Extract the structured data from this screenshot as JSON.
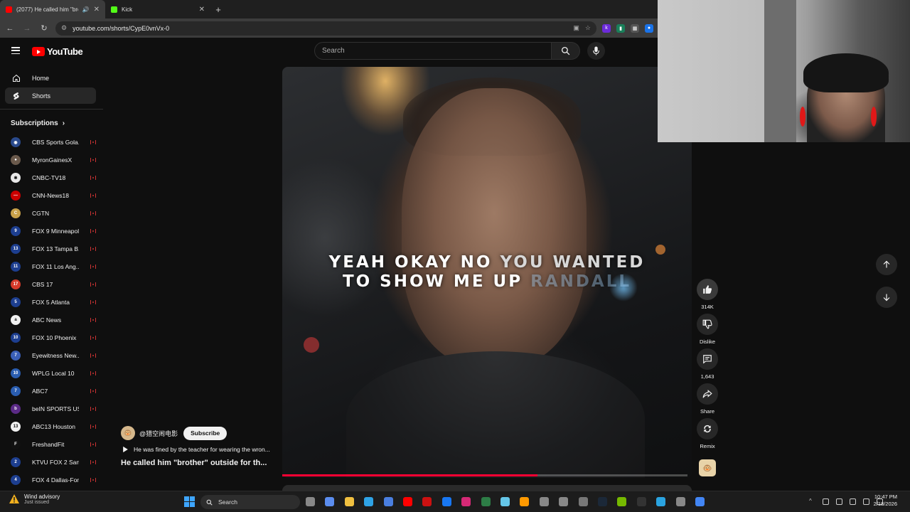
{
  "browser": {
    "tabs": [
      {
        "title": "(2077) He called him \"broth",
        "icon": "youtube-icon",
        "active": true
      },
      {
        "title": "Kick",
        "icon": "kick-icon",
        "active": false
      }
    ],
    "url": "youtube.com/shorts/CypE0vnVx-0"
  },
  "youtube": {
    "logo_text": "YouTube",
    "search_placeholder": "Search",
    "sidebar": {
      "home": "Home",
      "shorts": "Shorts",
      "subscriptions_heading": "Subscriptions",
      "subscriptions": [
        {
          "name": "CBS Sports Gola...",
          "color": "#2a4a8c",
          "glyph": "◉"
        },
        {
          "name": "MyronGainesX",
          "color": "#6b5a4c",
          "glyph": "●"
        },
        {
          "name": "CNBC-TV18",
          "color": "#e8e8e8",
          "glyph": "✱"
        },
        {
          "name": "CNN-News18",
          "color": "#cc0000",
          "glyph": "—"
        },
        {
          "name": "CGTN",
          "color": "#c9a24a",
          "glyph": "C"
        },
        {
          "name": "FOX 9 Minneapol...",
          "color": "#1d3e8f",
          "glyph": "9"
        },
        {
          "name": "FOX 13 Tampa B...",
          "color": "#1d3e8f",
          "glyph": "13"
        },
        {
          "name": "FOX 11 Los Ang...",
          "color": "#1d3e8f",
          "glyph": "11"
        },
        {
          "name": "CBS 17",
          "color": "#d63a2a",
          "glyph": "17"
        },
        {
          "name": "FOX 5 Atlanta",
          "color": "#1d3e8f",
          "glyph": "5"
        },
        {
          "name": "ABC News",
          "color": "#f1f1f1",
          "glyph": "a"
        },
        {
          "name": "FOX 10 Phoenix",
          "color": "#1d3e8f",
          "glyph": "10"
        },
        {
          "name": "Eyewitness New...",
          "color": "#3a5fb8",
          "glyph": "7"
        },
        {
          "name": "WPLG Local 10",
          "color": "#2a5db0",
          "glyph": "10"
        },
        {
          "name": "ABC7",
          "color": "#2a5db0",
          "glyph": "7"
        },
        {
          "name": "beIN SPORTS USA",
          "color": "#5b2a86",
          "glyph": "b"
        },
        {
          "name": "ABC13 Houston",
          "color": "#f1f1f1",
          "glyph": "13"
        },
        {
          "name": "FreshandFit",
          "color": "#111111",
          "glyph": "F"
        },
        {
          "name": "KTVU FOX 2 San...",
          "color": "#1d3e8f",
          "glyph": "2"
        },
        {
          "name": "FOX 4 Dallas-For...",
          "color": "#1d3e8f",
          "glyph": "4"
        }
      ]
    },
    "short": {
      "caption_line1_a": "YEAH OKAY NO ",
      "caption_line1_b": "YOU WANTED",
      "caption_line2_a": "TO SHOW ME UP ",
      "caption_line2_b": "RANDALL",
      "progress": 0.63,
      "channel_handle": "@猎空闹电影",
      "subscribe_label": "Subscribe",
      "description": "He was fined by the teacher for wearing the wron...",
      "title": "He called him \"brother\" outside for th...",
      "likes": "314K",
      "dislike_label": "Dislike",
      "comments": "1,643",
      "share_label": "Share",
      "remix_label": "Remix"
    }
  },
  "taskbar": {
    "weather_title": "Wind advisory",
    "weather_sub": "Just issued",
    "search_label": "Search",
    "time": "10:47 PM",
    "date": "2/18/2026"
  }
}
